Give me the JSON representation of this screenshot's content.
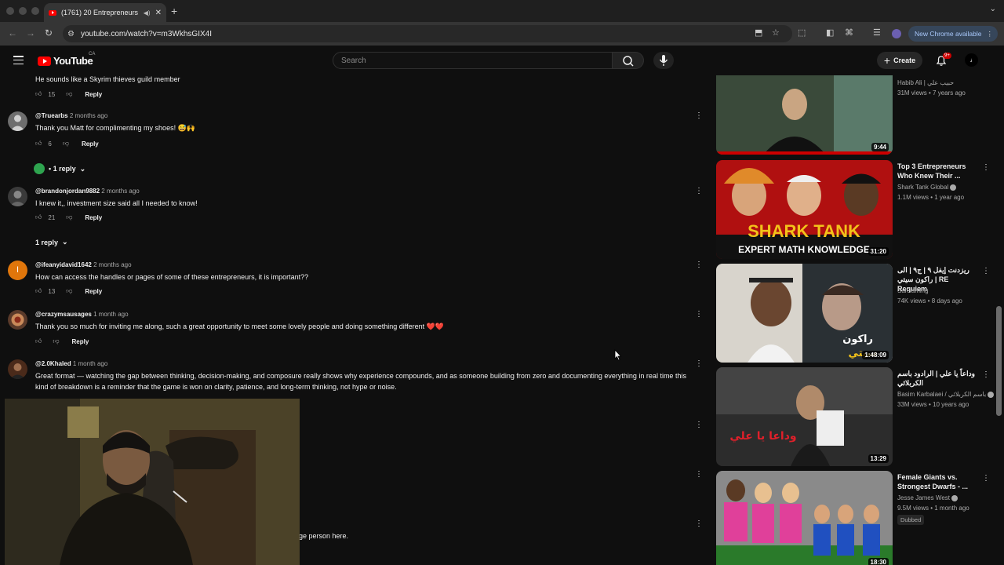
{
  "browser": {
    "tab_title": "(1761) 20 Entrepreneurs W",
    "new_tab": "+",
    "url": "youtube.com/watch?v=m3WkhsGIX4I",
    "new_chrome_label": "New Chrome available"
  },
  "header": {
    "logo_text": "YouTube",
    "country_code": "CA",
    "search_placeholder": "Search",
    "create_label": "Create",
    "notifications_badge": "9+",
    "account_initial": "ﻧ"
  },
  "comments": [
    {
      "handle": "",
      "time": "",
      "text": "He sounds like a Skyrim thieves guild member",
      "likes": "15",
      "reply": "Reply"
    },
    {
      "handle": "@Truearbs",
      "time": "2 months ago",
      "text": "Thank you Matt for complimenting my shoes! 😅🙌",
      "likes": "6",
      "reply": "Reply",
      "replies": "• 1 reply"
    },
    {
      "handle": "@brandonjordan9882",
      "time": "2 months ago",
      "text": "I knew it,, investment size said all I needed to know!",
      "likes": "21",
      "reply": "Reply",
      "replies": "1 reply"
    },
    {
      "handle": "@ifeanyidavid1642",
      "time": "2 months ago",
      "text": "How can access the handles or pages of some of these entrepreneurs, it is important??",
      "likes": "13",
      "reply": "Reply",
      "avatar_letter": "I"
    },
    {
      "handle": "@crazymsausages",
      "time": "1 month ago",
      "text": "Thank you so much for inviting me along, such a great opportunity to meet some lovely people and doing something different ❤️❤️",
      "likes": "",
      "reply": "Reply"
    },
    {
      "handle": "@2.0Khaled",
      "time": "1 month ago",
      "text": "Great format — watching the gap between thinking, decision-making, and composure really shows why experience compounds, and as someone building from zero and documenting everything in real time this kind of breakdown is a reminder that the game is won on clarity, patience, and long-term thinking, not hype or noise.",
      "likes": "",
      "reply": ""
    }
  ],
  "hidden_fragment": "ge person here.",
  "sidebar": [
    {
      "title": "",
      "channel": "Habib Ali | حبيب علي",
      "meta": "31M views • 7 years ago",
      "duration": "9:44",
      "thumb_color": "#2b3a2c"
    },
    {
      "title": "Top 3 Entrepreneurs Who Knew Their ...",
      "channel": "Shark Tank Global",
      "meta": "1.1M views • 1 year ago",
      "duration": "31:20",
      "thumb_text1": "SHARK TANK",
      "thumb_text2": "EXPERT MATH KNOWLEDGE"
    },
    {
      "title": "ريزدنت إيفل ٩ | ج٩ | الى راكون سيتي | RE Requiem",
      "channel": "SalGaming",
      "meta": "74K views • 8 days ago",
      "duration": "1:48:09",
      "thumb_text1": "راكون",
      "thumb_text2": "سيتي"
    },
    {
      "title": "وداعاً يا علي | الرادود باسم الكربلائي",
      "channel": "Basim Karbalaei / باسم الكربلائي",
      "meta": "33M views • 10 years ago",
      "duration": "13:29",
      "thumb_text1": "وداعا يا علي"
    },
    {
      "title": "Female Giants vs. Strongest Dwarfs - ...",
      "channel": "Jesse James West",
      "meta": "9.5M views • 1 month ago",
      "duration": "18:30",
      "badge": "Dubbed"
    }
  ]
}
